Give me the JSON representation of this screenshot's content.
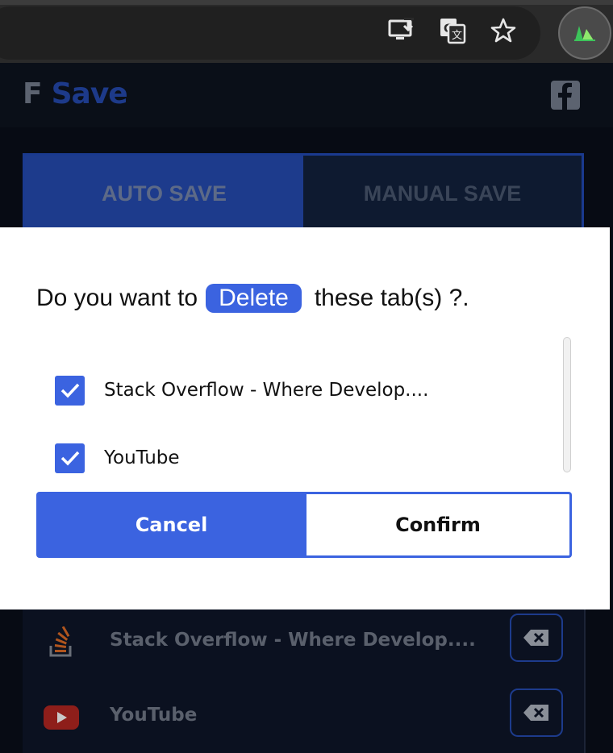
{
  "browser": {
    "toolbar_icons": [
      "install-app-icon",
      "translate-icon",
      "bookmark-star-icon",
      "extension-icon"
    ]
  },
  "app": {
    "logo_letter": "F",
    "logo_text": "Save",
    "social_icon": "facebook-icon"
  },
  "tabs": [
    {
      "label": "AUTO SAVE",
      "active": true
    },
    {
      "label": "MANUAL SAVE",
      "active": false
    }
  ],
  "dialog": {
    "question_before": "Do you want to",
    "action_label": "Delete",
    "question_after": "these tab(s) ?.",
    "items": [
      {
        "label": "Stack Overflow - Where Develop....",
        "checked": true
      },
      {
        "label": "YouTube",
        "checked": true
      }
    ],
    "cancel_label": "Cancel",
    "confirm_label": "Confirm"
  },
  "saved_tabs": [
    {
      "label": "Stack Overflow - Where Develop....",
      "icon": "stackoverflow-icon"
    },
    {
      "label": "YouTube",
      "icon": "youtube-icon"
    }
  ],
  "colors": {
    "accent": "#3b63e0",
    "dark_bg": "#070b14",
    "brand_dark": "#1d3b8c"
  }
}
